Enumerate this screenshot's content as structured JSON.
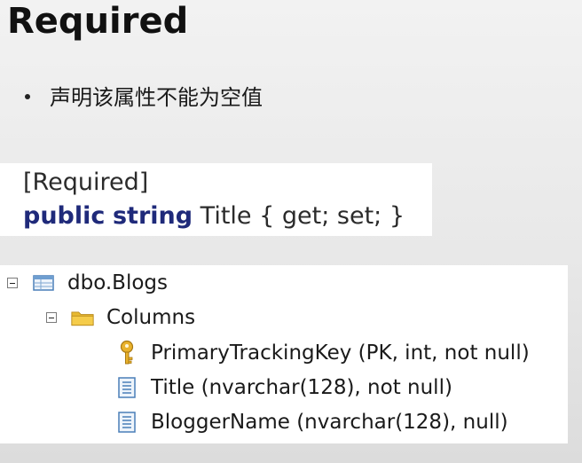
{
  "slide": {
    "title": "Required",
    "bullet": "声明该属性不能为空值"
  },
  "code": {
    "line1": "[Required]",
    "keyword1": "public",
    "keyword2": "string",
    "rest": " Title { get; set; }"
  },
  "tree": {
    "table": {
      "label": "dbo.Blogs",
      "icon": "table-icon"
    },
    "folder": {
      "label": "Columns",
      "icon": "folder-icon"
    },
    "columns": [
      {
        "label": "PrimaryTrackingKey (PK, int, not null)",
        "icon": "key-icon"
      },
      {
        "label": "Title (nvarchar(128), not null)",
        "icon": "column-icon"
      },
      {
        "label": "BloggerName (nvarchar(128), null)",
        "icon": "column-icon"
      }
    ]
  },
  "colors": {
    "keyword": "#1f2a7a",
    "folder": "#e8b930",
    "key": "#d9a21b"
  }
}
